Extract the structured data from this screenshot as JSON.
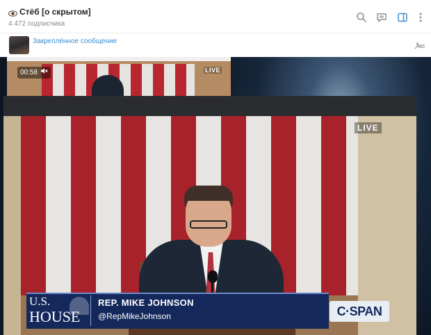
{
  "header": {
    "channel_title": "Стёб [о скрытом]",
    "subscribers": "4 472 подписчика",
    "icons": [
      "eye-icon",
      "search-icon",
      "comments-icon",
      "sidebar-toggle-icon",
      "more-vertical-icon"
    ]
  },
  "pinned": {
    "label": "Закреплённое сообщение",
    "icon": "unpin-icon"
  },
  "top_video": {
    "time": "00:58",
    "muted_icon": "speaker-muted-icon",
    "live": "LIVE"
  },
  "main_video": {
    "live": "LIVE",
    "logo_us": "U.S.",
    "logo_house": "HOUSE",
    "name": "REP. MIKE JOHNSON",
    "handle": "@RepMikeJohnson",
    "network": "C·SPAN"
  },
  "colors": {
    "link_blue": "#3a8dd0",
    "lower_third_navy": "#14285c",
    "flag_red": "#a8222b"
  }
}
